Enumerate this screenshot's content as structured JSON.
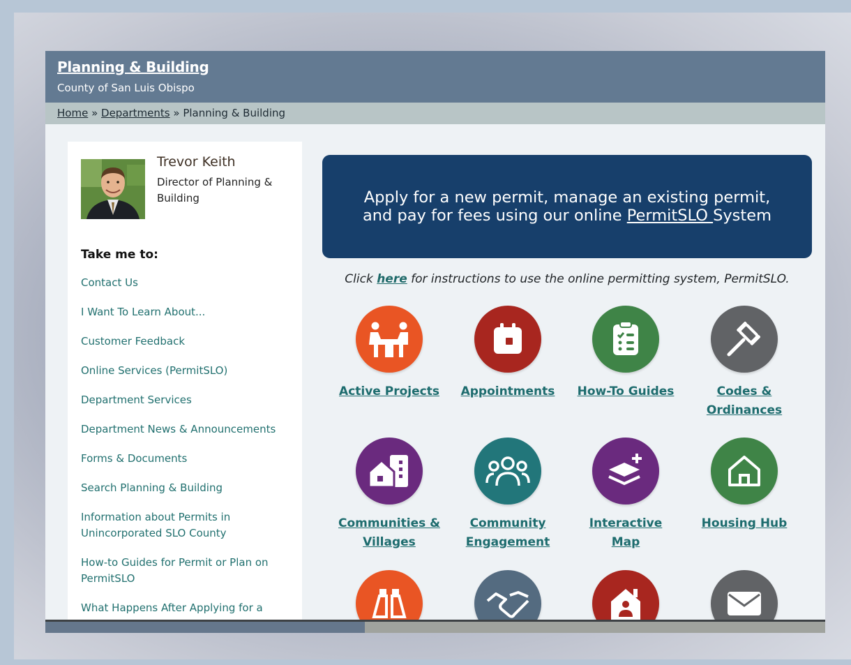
{
  "header": {
    "title": "Planning & Building",
    "subtitle": "County of San Luis Obispo"
  },
  "breadcrumb": {
    "home": "Home",
    "sep1": " » ",
    "departments": "Departments",
    "sep2": " » ",
    "current": "Planning & Building"
  },
  "director": {
    "name": "Trevor Keith",
    "title": "Director of Planning & Building"
  },
  "sidebar": {
    "heading": "Take me to:",
    "items": [
      {
        "label": "Contact Us"
      },
      {
        "label": "I Want To Learn About..."
      },
      {
        "label": "Customer Feedback"
      },
      {
        "label": "Online Services (PermitSLO)"
      },
      {
        "label": "Department Services"
      },
      {
        "label": "Department News & Announcements"
      },
      {
        "label": "Forms & Documents"
      },
      {
        "label": "Search Planning & Building"
      },
      {
        "label": "Information about Permits in Unincorporated SLO County"
      },
      {
        "label": "How-to Guides for Permit or Plan on PermitSLO"
      },
      {
        "label": "What Happens After Applying for a"
      }
    ]
  },
  "banner": {
    "text_before": "Apply for a new permit, manage an existing permit, and pay for fees using our online ",
    "link": " PermitSLO ",
    "text_after": " System"
  },
  "instructions": {
    "before": "Click ",
    "link": "here",
    "after": " for instructions to use the online permitting system, PermitSLO."
  },
  "colors": {
    "orange": "#e95524",
    "red": "#a8261f",
    "green": "#3f8447",
    "gray": "#616366",
    "purple": "#6a2a7e",
    "teal": "#22767a",
    "slate": "#546b80"
  },
  "tiles": [
    {
      "label": "Active Projects",
      "icon": "people-meeting-icon",
      "color": "#e95524"
    },
    {
      "label": "Appointments",
      "icon": "calendar-icon",
      "color": "#a8261f"
    },
    {
      "label": "How-To Guides",
      "icon": "clipboard-checklist-icon",
      "color": "#3f8447"
    },
    {
      "label": "Codes & Ordinances",
      "icon": "gavel-icon",
      "color": "#616366"
    },
    {
      "label": "Communities & Villages",
      "icon": "house-buildings-icon",
      "color": "#6a2a7e"
    },
    {
      "label": "Community Engagement",
      "icon": "group-people-icon",
      "color": "#22767a"
    },
    {
      "label": "Interactive Map",
      "icon": "map-layers-icon",
      "color": "#6a2a7e"
    },
    {
      "label": "Housing Hub",
      "icon": "house-icon",
      "color": "#3f8447"
    },
    {
      "label": "",
      "icon": "binoculars-icon",
      "color": "#e95524"
    },
    {
      "label": "",
      "icon": "handshake-icon",
      "color": "#546b80"
    },
    {
      "label": "",
      "icon": "house-person-icon",
      "color": "#a8261f"
    },
    {
      "label": "",
      "icon": "envelope-icon",
      "color": "#616366"
    }
  ]
}
